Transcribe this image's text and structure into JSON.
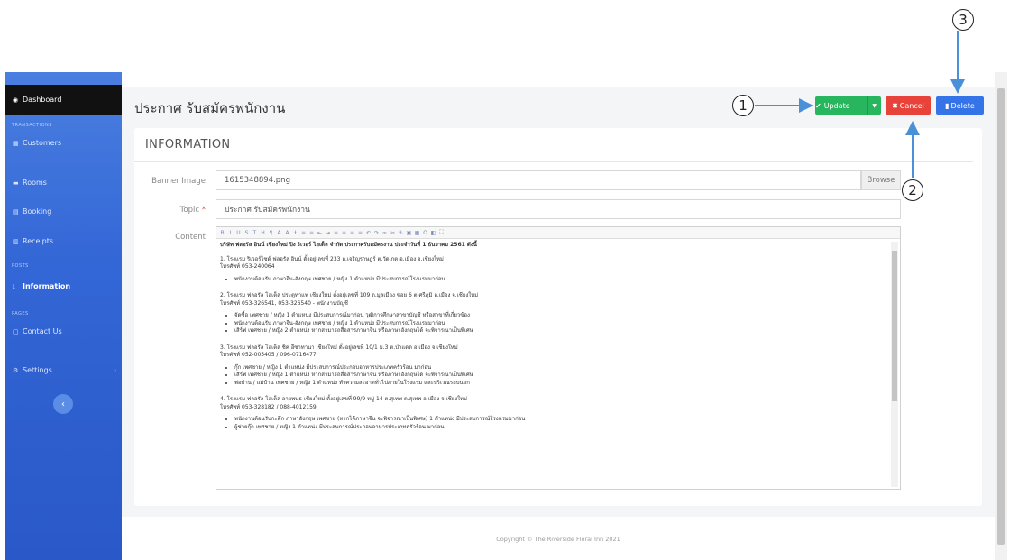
{
  "sidebar": {
    "active": "Dashboard",
    "sections": [
      "TRANSACTIONS",
      "POSTS",
      "PAGES"
    ],
    "items": [
      {
        "label": "Customers",
        "icon": "users-icon"
      },
      {
        "label": "Rooms",
        "icon": "bed-icon"
      },
      {
        "label": "Booking",
        "icon": "booking-icon"
      },
      {
        "label": "Receipts",
        "icon": "receipt-icon"
      },
      {
        "label": "Information",
        "icon": "info-icon"
      },
      {
        "label": "Contact Us",
        "icon": "contact-icon"
      },
      {
        "label": "Settings",
        "icon": "gear-icon"
      }
    ],
    "collapse_icon": "chevron-left-icon",
    "color": "#3366d6"
  },
  "page": {
    "title": "ประกาศ รับสมัครพนักงาน",
    "buttons": {
      "update": "Update",
      "cancel": "Cancel",
      "delete": "Delete"
    },
    "colors": {
      "update": "#27b65d",
      "cancel": "#e8433a",
      "delete": "#3574e8"
    }
  },
  "form": {
    "section_title": "INFORMATION",
    "banner_label": "Banner Image",
    "banner_value": "1615348894.png",
    "browse_label": "Browse",
    "topic_label": "Topic",
    "topic_required": "*",
    "topic_value": "ประกาศ รับสมัครพนักงาน",
    "content_label": "Content"
  },
  "editor": {
    "heading": "บริษัท ฟลอรัล อินน์ เชียงใหม่ ปิง ริเวอร์ ไฮเต็ล จำกัด ประกาศรับสมัครงาน ประจำวันที่ 1 ธันวาคม 2561 ดังนี้",
    "blocks": [
      {
        "title": "1. โรงแรม ริเวอร์ไซด์ ฟลอรัล อินน์ ตั้งอยู่เลขที่ 233 ถ.เจริญราษฎร์ ต.วัดเกต อ.เมือง จ.เชียงใหม่",
        "phone": "โทรศัพท์ 053-240064",
        "items": [
          "พนักงานต้อนรับ ภาษาจีน-อังกฤษ เพศชาย / หญิง 1 ตำแหน่ง มีประสบการณ์โรงแรมมาก่อน"
        ]
      },
      {
        "title": "2. โรงแรม ฟลอรัล โฮเต็ล ประตูท่าแพ เชียงใหม่ ตั้งอยู่เลขที่ 109 ถ.มูลเมือง ซอย 6 ต.ศรีภูมิ อ.เมือง จ.เชียงใหม่",
        "phone": "โทรศัพท์ 053-326541, 053-326540 - พนักงานบัญชี",
        "items": [
          "จัดซื้อ เพศชาย / หญิง 1 ตำแหน่ง มีประสบการณ์มาก่อน วุฒิการศึกษาสาขาบัญชี หรือสาขาที่เกี่ยวข้อง",
          "พนักงานต้อนรับ ภาษาจีน-อังกฤษ เพศชาย / หญิง 1 ตำแหน่ง มีประสบการณ์โรงแรมมาก่อน",
          "เสิร์ฟ เพศชาย / หญิง 2 ตำแหน่ง หากสามารถสื่อสารภาษาจีน หรือภาษาอังกฤษได้ จะพิจารณาเป็นพิเศษ"
        ]
      },
      {
        "title": "3. โรงแรม ฟลอรัล โฮเต็ล ชิค อีซาทานา เชียงใหม่ ตั้งอยู่เลขที่ 10/1 ม.3 ต.ป่าแดด อ.เมือง จ.เชียงใหม่",
        "phone": "โทรศัพท์ 052-005405 / 096-0716477",
        "items": [
          "กุ๊ก เพศชาย / หญิง 1 ตำแหน่ง มีประสบการณ์ประกอบอาหารประเภทครัวร้อน มาก่อน",
          "เสิร์ฟ เพศชาย / หญิง 1 ตำแหน่ง หากสามารถสื่อสารภาษาจีน หรือภาษาอังกฤษได้ จะพิจารณาเป็นพิเศษ",
          "พ่อบ้าน / แม่บ้าน เพศชาย / หญิง 1 ตำแหน่ง ทำความสะอาดทั่วไปภายในโรงแรม และบริเวณรอบนอก"
        ]
      },
      {
        "title": "4. โรงแรม ฟลอรัล โฮเต็ล อายพนธ เชียงใหม่ ตั้งอยู่เลขที่ 99/9 หมู่ 14 ต.สุเทพ ต.สุเทพ อ.เมือง จ.เชียงใหม่",
        "phone": "โทรศัพท์ 053-328182 / 088-4012159",
        "items": [
          "พนักงานต้อนรับกะดึก ภาษาอังกฤษ เพศชาย (หากได้ภาษาจีน จะพิจารณาเป็นพิเศษ) 1 ตำแหน่ง มีประสบการณ์โรงแรมมาก่อน",
          "ผู้ช่วยกุ๊ก เพศชาย / หญิง 1 ตำแหน่ง มีประสบการณ์ประกอบอาหารประเภทครัวร้อน มาก่อน"
        ]
      }
    ]
  },
  "footer": "Copyright © The Riverside Floral Inn 2021",
  "callouts": [
    "1",
    "2",
    "3"
  ]
}
